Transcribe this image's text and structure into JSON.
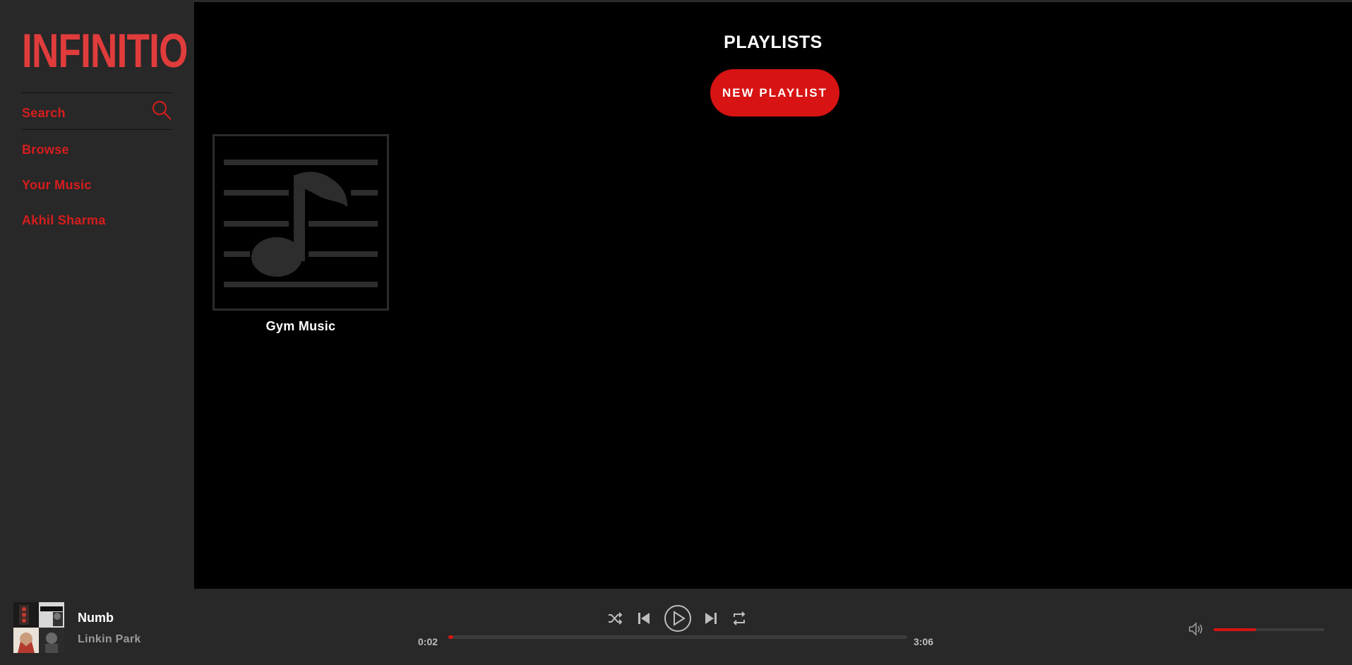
{
  "app": {
    "logo_text": "INFINITIO"
  },
  "sidebar": {
    "search_label": "Search",
    "items": [
      {
        "label": "Browse"
      },
      {
        "label": "Your Music"
      },
      {
        "label": "Akhil Sharma"
      }
    ]
  },
  "main": {
    "title": "PLAYLISTS",
    "new_playlist_label": "NEW PLAYLIST",
    "playlists": [
      {
        "name": "Gym Music",
        "icon": "music-note-icon"
      }
    ]
  },
  "player": {
    "song_title": "Numb",
    "artist": "Linkin Park",
    "current_time": "0:02",
    "total_time": "3:06",
    "progress_fraction": 0.01,
    "volume_fraction": 0.38,
    "icons": [
      "shuffle-icon",
      "previous-icon",
      "play-icon",
      "next-icon",
      "repeat-icon",
      "volume-icon"
    ]
  },
  "colors": {
    "accent": "#d81313",
    "logo": "#e03c3c",
    "sidebar_bg": "#282828",
    "main_bg": "#000000"
  }
}
